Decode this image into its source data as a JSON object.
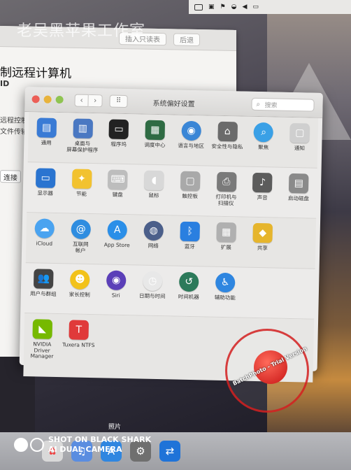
{
  "watermark_top": "老吴黑苹果工作室",
  "back_window": {
    "btn_jump": "插入只读表",
    "btn_back": "后退",
    "title": "制远程计算机",
    "subtitle": "ID",
    "line1": "远程控制",
    "line2": "文件传输",
    "connect": "连接"
  },
  "prefs": {
    "title": "系统偏好设置",
    "search_placeholder": "搜索",
    "rows": [
      [
        {
          "name": "general",
          "label": "通用",
          "icon": "▤",
          "color": "#3a7bd5"
        },
        {
          "name": "desktop",
          "label": "桌面与\n屏幕保护程序",
          "icon": "▥",
          "color": "#4a78c2"
        },
        {
          "name": "dock",
          "label": "程序坞",
          "icon": "▭",
          "color": "#222222"
        },
        {
          "name": "mission",
          "label": "调度中心",
          "icon": "▦",
          "color": "#2f6b43"
        },
        {
          "name": "language",
          "label": "语言与地区",
          "icon": "◉",
          "color": "#3a86d6"
        },
        {
          "name": "security",
          "label": "安全性与隐私",
          "icon": "⌂",
          "color": "#6b6b6b"
        },
        {
          "name": "spotlight",
          "label": "聚焦",
          "icon": "⌕",
          "color": "#3aa0e6"
        },
        {
          "name": "notifications",
          "label": "通知",
          "icon": "▢",
          "color": "#cfcfcf"
        }
      ],
      [
        {
          "name": "displays",
          "label": "显示器",
          "icon": "▭",
          "color": "#2a74d0"
        },
        {
          "name": "energy",
          "label": "节能",
          "icon": "✦",
          "color": "#f2c230"
        },
        {
          "name": "keyboard",
          "label": "键盘",
          "icon": "⌨",
          "color": "#bdbdbd"
        },
        {
          "name": "mouse",
          "label": "鼠标",
          "icon": "◖",
          "color": "#d8d8d8"
        },
        {
          "name": "trackpad",
          "label": "触控板",
          "icon": "▢",
          "color": "#a9a9a9"
        },
        {
          "name": "printers",
          "label": "打印机与\n扫描仪",
          "icon": "⎙",
          "color": "#7a7a7a"
        },
        {
          "name": "sound",
          "label": "声音",
          "icon": "♪",
          "color": "#5c5c5c"
        },
        {
          "name": "startup",
          "label": "启动磁盘",
          "icon": "▤",
          "color": "#8a8a8a"
        }
      ],
      [
        {
          "name": "icloud",
          "label": "iCloud",
          "icon": "☁",
          "color": "#4aa3f0"
        },
        {
          "name": "internet",
          "label": "互联网\n帐户",
          "icon": "@",
          "color": "#2f8de0"
        },
        {
          "name": "appstore",
          "label": "App Store",
          "icon": "A",
          "color": "#2b8fe8"
        },
        {
          "name": "network",
          "label": "网络",
          "icon": "◍",
          "color": "#4b5f8a"
        },
        {
          "name": "bluetooth",
          "label": "蓝牙",
          "icon": "ᛒ",
          "color": "#2a7fe0"
        },
        {
          "name": "extensions",
          "label": "扩展",
          "icon": "▦",
          "color": "#b0b0b0"
        },
        {
          "name": "sharing",
          "label": "共享",
          "icon": "◆",
          "color": "#e6b52c"
        }
      ],
      [
        {
          "name": "users",
          "label": "用户与群组",
          "icon": "👥",
          "color": "#444444"
        },
        {
          "name": "parental",
          "label": "家长控制",
          "icon": "☻",
          "color": "#f2c21a"
        },
        {
          "name": "siri",
          "label": "Siri",
          "icon": "◉",
          "color": "#5b3fb8"
        },
        {
          "name": "datetime",
          "label": "日期与时间",
          "icon": "◷",
          "color": "#e8e8e8"
        },
        {
          "name": "timemachine",
          "label": "时间机器",
          "icon": "↺",
          "color": "#2c7a5a"
        },
        {
          "name": "accessibility",
          "label": "辅助功能",
          "icon": "♿",
          "color": "#2f86e0"
        }
      ],
      [
        {
          "name": "nvidia",
          "label": "NVIDIA\nDriver Manager",
          "icon": "◣",
          "color": "#76b900"
        },
        {
          "name": "tuxera",
          "label": "Tuxera NTFS",
          "icon": "T",
          "color": "#e03a3a"
        }
      ]
    ]
  },
  "badge_text": "BatchPhoto - Trial Version",
  "photos_label": "照片",
  "camera": {
    "line1": "SHOT ON BLACK SHARK",
    "line2": "AI DUAL CAMERA"
  }
}
